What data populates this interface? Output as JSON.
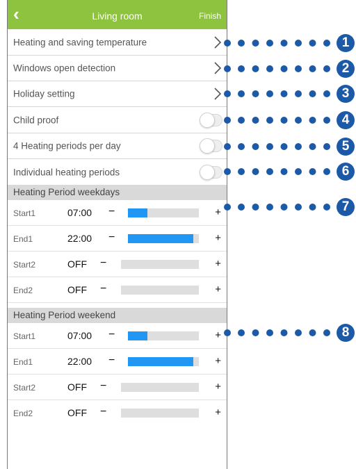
{
  "header": {
    "back_icon": "chevron-left-icon",
    "title": "Living room",
    "finish_label": "Finish",
    "color": "#8dc33f"
  },
  "settings": [
    {
      "label": "Heating and saving temperature",
      "control": "chevron"
    },
    {
      "label": "Windows open detection",
      "control": "chevron"
    },
    {
      "label": "Holiday setting",
      "control": "chevron"
    },
    {
      "label": "Child proof",
      "control": "toggle",
      "on": false
    },
    {
      "label": "4 Heating periods per day",
      "control": "toggle",
      "on": false
    },
    {
      "label": "Individual heating periods",
      "control": "toggle",
      "on": false
    }
  ],
  "weekdays": {
    "header": "Heating Period weekdays",
    "rows": [
      {
        "label": "Start1",
        "time": "07:00",
        "level": 0.27
      },
      {
        "label": "End1",
        "time": "22:00",
        "level": 0.92
      },
      {
        "label": "Start2",
        "time": "OFF",
        "level": 0
      },
      {
        "label": "End2",
        "time": "OFF",
        "level": 0
      }
    ]
  },
  "weekend": {
    "header": "Heating Period weekend",
    "rows": [
      {
        "label": "Start1",
        "time": "07:00",
        "level": 0.27
      },
      {
        "label": "End1",
        "time": "22:00",
        "level": 0.92
      },
      {
        "label": "Start2",
        "time": "OFF",
        "level": 0
      },
      {
        "label": "End2",
        "time": "OFF",
        "level": 0
      }
    ]
  },
  "controls": {
    "minus": "−",
    "plus": "+"
  },
  "callouts": [
    "1",
    "2",
    "3",
    "4",
    "5",
    "6",
    "7",
    "8"
  ],
  "colors": {
    "accent": "#8dc33f",
    "bar_fill": "#2196f3",
    "bar_track": "#dedede",
    "callout": "#1c5aa8"
  }
}
